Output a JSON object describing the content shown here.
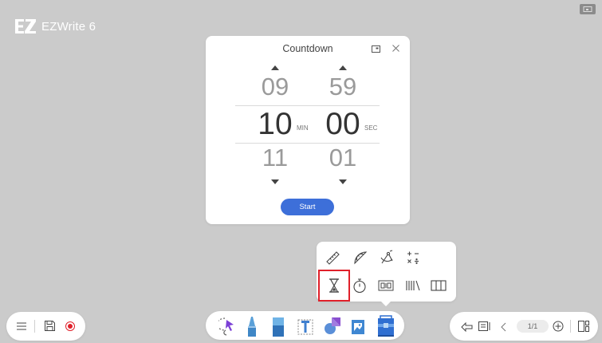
{
  "app": {
    "logo_text": "EZWrite 6"
  },
  "countdown": {
    "title": "Countdown",
    "minutes": {
      "prev": "09",
      "current": "10",
      "next": "11",
      "unit": "MIN"
    },
    "seconds": {
      "prev": "59",
      "current": "00",
      "next": "01",
      "unit": "SEC"
    },
    "start_label": "Start"
  },
  "tools_popup": {
    "row1": [
      "ruler-icon",
      "protractor-icon",
      "compass-icon",
      "calculator-icon"
    ],
    "row2": [
      "hourglass-icon",
      "stopwatch-icon",
      "scoreboard-icon",
      "abacus-icon",
      "grid-icon"
    ],
    "highlighted": "hourglass-icon"
  },
  "bottom_left": [
    "menu-icon",
    "save-icon",
    "record-icon"
  ],
  "bottom_center": [
    "lasso-icon",
    "pen-icon",
    "eraser-icon",
    "text-icon",
    "shapes-icon",
    "image-icon",
    "toolbox-icon"
  ],
  "bottom_right": {
    "page_indicator": "1/1"
  },
  "colors": {
    "accent": "#3d6fd9",
    "highlight": "#e0202a",
    "background": "#cbcbcb"
  }
}
